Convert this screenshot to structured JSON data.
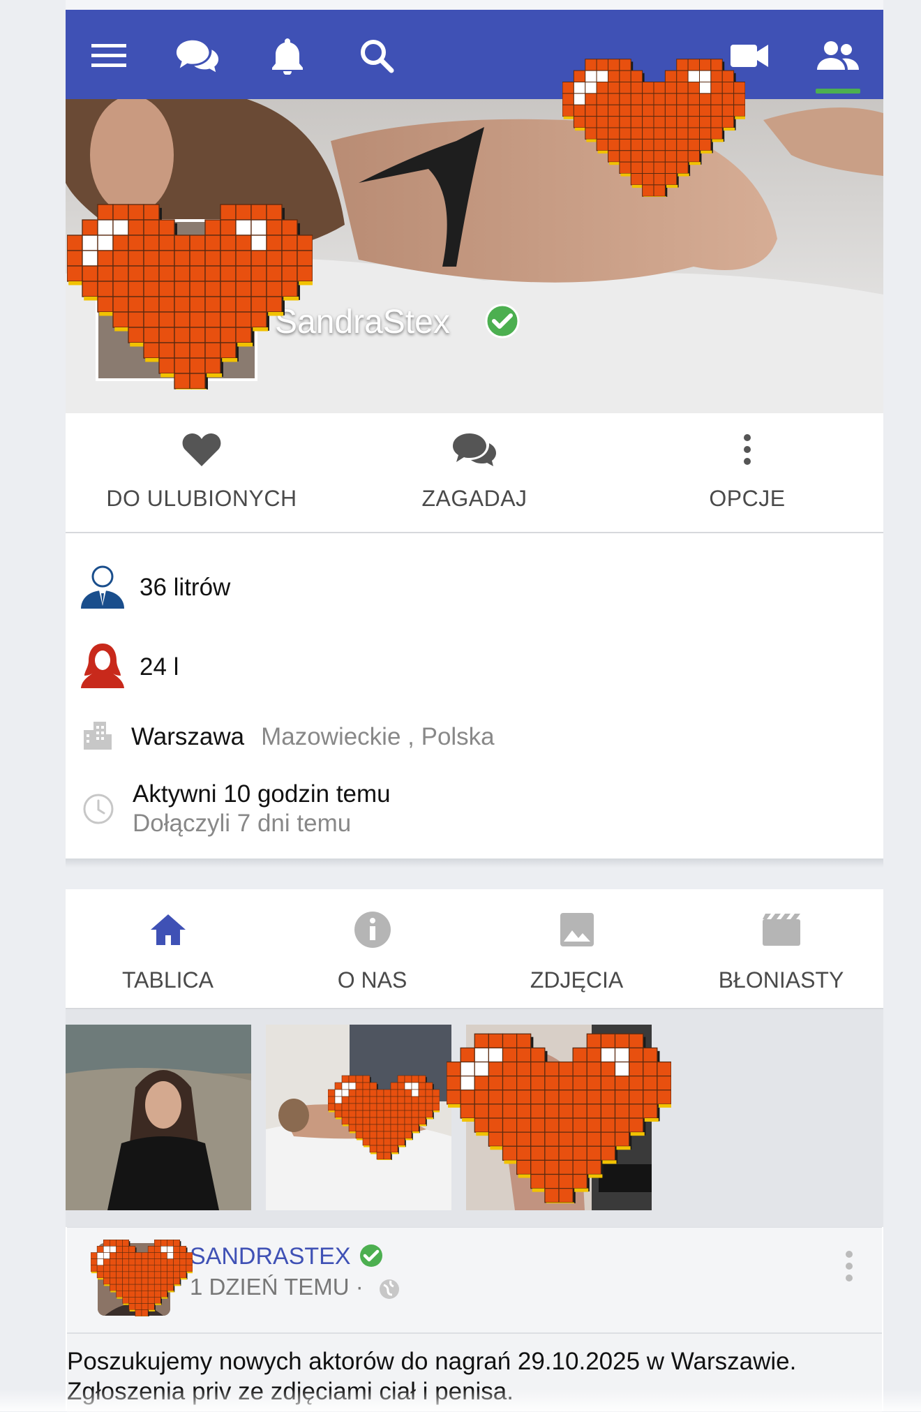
{
  "navbar": {
    "icons": [
      "menu-icon",
      "chat-icon",
      "bell-icon",
      "search-icon",
      "video-icon",
      "people-icon"
    ],
    "bg_color": "#3f51b5",
    "active_indicator_color": "#4caf50"
  },
  "profile": {
    "name": "SandraStex",
    "verified": true
  },
  "actions": [
    {
      "label": "DO ULUBIONYCH",
      "icon": "heart-icon"
    },
    {
      "label": "ZAGADAJ",
      "icon": "chat-icon"
    },
    {
      "label": "OPCJE",
      "icon": "more-vert-icon"
    }
  ],
  "info": {
    "male_value": "36 litrów",
    "female_value": "24 l",
    "city": "Warszawa",
    "region": "Mazowieckie , Polska",
    "active": "Aktywni 10 godzin temu",
    "joined": "Dołączyli 7 dni temu"
  },
  "tabs": [
    {
      "label": "TABLICA",
      "icon": "home-icon",
      "active": true
    },
    {
      "label": "O NAS",
      "icon": "info-icon"
    },
    {
      "label": "ZDJĘCIA",
      "icon": "image-icon"
    },
    {
      "label": "BŁONIASTY",
      "icon": "movie-icon"
    }
  ],
  "post": {
    "author": "SANDRASTEX",
    "time": "1 DZIEŃ TEMU ·",
    "body_line1": "Poszukujemy nowych aktorów do nagrań 29.10.2025 w Warszawie.",
    "body_line2": "Zgłoszenia priv ze zdjęciami ciał i penisa."
  }
}
